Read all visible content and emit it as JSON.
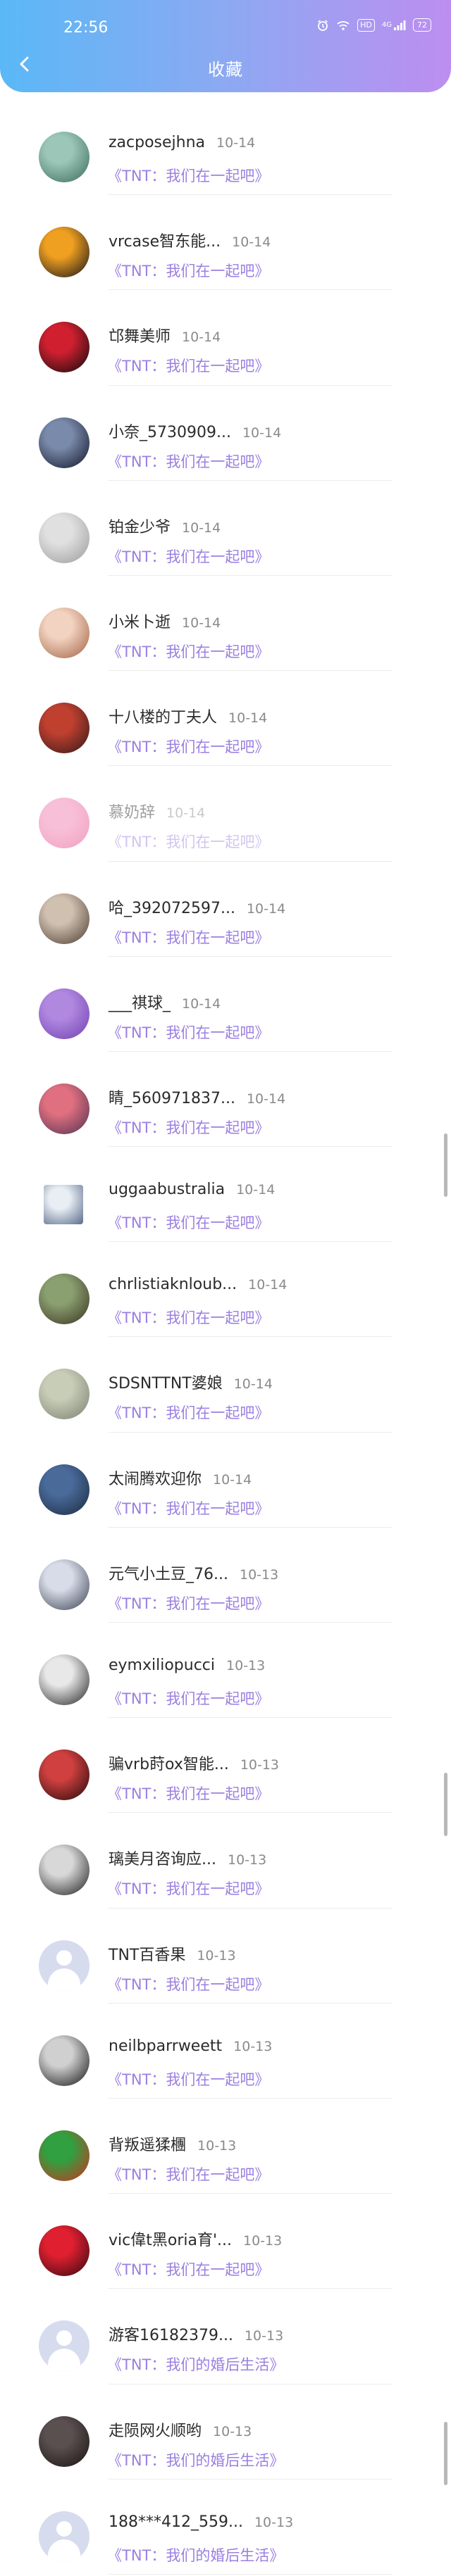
{
  "status_bar": {
    "time": "22:56",
    "icons": [
      "alarm-icon",
      "wifi-icon",
      "hd-icon",
      "signal-icon",
      "battery-icon"
    ],
    "hd_label": "HD",
    "signal_label": "4G",
    "battery_label": "72"
  },
  "header": {
    "title": "收藏",
    "back_icon": "chevron-left-icon"
  },
  "colors": {
    "header_start": "#5ab8f6",
    "header_end": "#bd8ef0",
    "message_accent": "#9b7fe0"
  },
  "items": [
    {
      "name": "zacposejhna",
      "date": "10-14",
      "message": "《TNT：我们在一起吧》",
      "avatar": "photo",
      "colors": [
        "#9cc7b8",
        "#3a6a5a"
      ]
    },
    {
      "name": "vrcase智东能...",
      "date": "10-14",
      "message": "《TNT：我们在一起吧》",
      "avatar": "photo",
      "colors": [
        "#f0a020",
        "#10101a"
      ]
    },
    {
      "name": "邙舞美师",
      "date": "10-14",
      "message": "《TNT：我们在一起吧》",
      "avatar": "photo",
      "colors": [
        "#d02030",
        "#0a0a0a"
      ]
    },
    {
      "name": "小奈_5730909...",
      "date": "10-14",
      "message": "《TNT：我们在一起吧》",
      "avatar": "photo",
      "colors": [
        "#7a8aaa",
        "#101428"
      ]
    },
    {
      "name": "铂金少爷",
      "date": "10-14",
      "message": "《TNT：我们在一起吧》",
      "avatar": "photo",
      "colors": [
        "#e0e0e0",
        "#9a9a9a"
      ]
    },
    {
      "name": "小米卜逝",
      "date": "10-14",
      "message": "《TNT：我们在一起吧》",
      "avatar": "photo",
      "colors": [
        "#f2d2c0",
        "#a06040"
      ]
    },
    {
      "name": "十八楼的丁夫人",
      "date": "10-14",
      "message": "《TNT：我们在一起吧》",
      "avatar": "photo",
      "colors": [
        "#c04030",
        "#301818"
      ]
    },
    {
      "name": "慕奶辞",
      "date": "10-14",
      "message": "《TNT：我们在一起吧》",
      "avatar": "photo",
      "colors": [
        "#f8c0d8",
        "#f0a0c0"
      ],
      "dim": true
    },
    {
      "name": "哈_392072597...",
      "date": "10-14",
      "message": "《TNT：我们在一起吧》",
      "avatar": "photo",
      "colors": [
        "#d0c0b0",
        "#4a3a30"
      ]
    },
    {
      "name": "___祺球_",
      "date": "10-14",
      "message": "《TNT：我们在一起吧》",
      "avatar": "photo",
      "colors": [
        "#b088e0",
        "#7040b0"
      ]
    },
    {
      "name": "睛_560971837...",
      "date": "10-14",
      "message": "《TNT：我们在一起吧》",
      "avatar": "photo",
      "colors": [
        "#e07080",
        "#503050"
      ]
    },
    {
      "name": "uggaabustralia",
      "date": "10-14",
      "message": "《TNT：我们在一起吧》",
      "avatar": "square",
      "colors": [
        "#e8eef4",
        "#5a6a8a"
      ]
    },
    {
      "name": "chrlistiaknloub...",
      "date": "10-14",
      "message": "《TNT：我们在一起吧》",
      "avatar": "photo",
      "colors": [
        "#8aa070",
        "#3a3020"
      ]
    },
    {
      "name": "SDSNTTNT婆娘",
      "date": "10-14",
      "message": "《TNT：我们在一起吧》",
      "avatar": "photo",
      "colors": [
        "#c8cdb8",
        "#7a8070"
      ]
    },
    {
      "name": "太闹腾欢迎你",
      "date": "10-14",
      "message": "《TNT：我们在一起吧》",
      "avatar": "photo",
      "colors": [
        "#4a6a9a",
        "#1a2a40"
      ]
    },
    {
      "name": "元气小土豆_76...",
      "date": "10-13",
      "message": "《TNT：我们在一起吧》",
      "avatar": "photo",
      "colors": [
        "#d8dce8",
        "#3a4050"
      ]
    },
    {
      "name": "eymxiliopucci",
      "date": "10-13",
      "message": "《TNT：我们在一起吧》",
      "avatar": "photo",
      "colors": [
        "#e8e8e8",
        "#202020"
      ]
    },
    {
      "name": "骗vrb莳ox智能...",
      "date": "10-13",
      "message": "《TNT：我们在一起吧》",
      "avatar": "photo",
      "colors": [
        "#d04040",
        "#200808"
      ]
    },
    {
      "name": "璃美月咨询应...",
      "date": "10-13",
      "message": "《TNT：我们在一起吧》",
      "avatar": "photo",
      "colors": [
        "#d8d8d8",
        "#1a1a1a"
      ]
    },
    {
      "name": "TNT百香果",
      "date": "10-13",
      "message": "《TNT：我们在一起吧》",
      "avatar": "default",
      "colors": [
        "#d6dcee",
        "#ffffff"
      ]
    },
    {
      "name": "neilbparrweett",
      "date": "10-13",
      "message": "《TNT：我们在一起吧》",
      "avatar": "photo",
      "colors": [
        "#d0d0d0",
        "#101010"
      ]
    },
    {
      "name": "背叛遥猱檲",
      "date": "10-13",
      "message": "《TNT：我们在一起吧》",
      "avatar": "photo",
      "colors": [
        "#30a040",
        "#d03020"
      ]
    },
    {
      "name": "vic偉t黑oria育'...",
      "date": "10-13",
      "message": "《TNT：我们在一起吧》",
      "avatar": "photo",
      "colors": [
        "#e02030",
        "#300810"
      ]
    },
    {
      "name": "游客16182379...",
      "date": "10-13",
      "message": "《TNT：我们的婚后生活》",
      "avatar": "default",
      "colors": [
        "#d6dcee",
        "#ffffff"
      ]
    },
    {
      "name": "走陨网火顺哟",
      "date": "10-13",
      "message": "《TNT：我们的婚后生活》",
      "avatar": "photo",
      "colors": [
        "#5a5050",
        "#181010"
      ]
    },
    {
      "name": "188***412_559...",
      "date": "10-13",
      "message": "《TNT：我们的婚后生活》",
      "avatar": "default",
      "colors": [
        "#d6dcee",
        "#ffffff"
      ]
    }
  ]
}
